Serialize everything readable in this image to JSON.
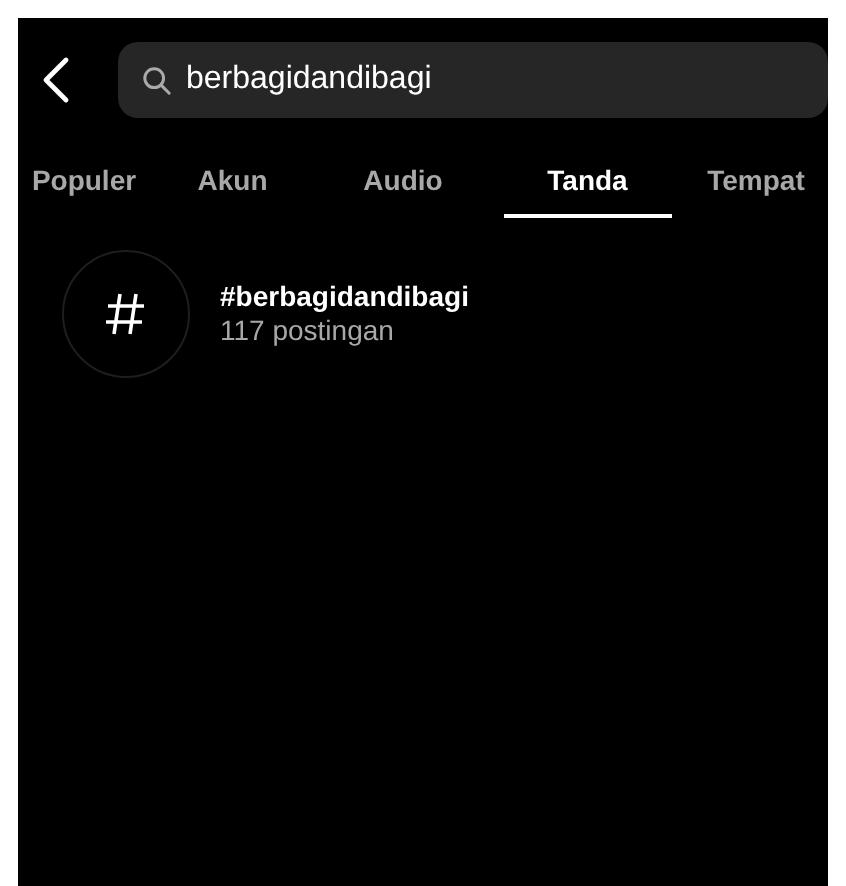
{
  "search": {
    "value": "berbagidandibagi"
  },
  "tabs": [
    {
      "label": "Populer",
      "selected": false
    },
    {
      "label": "Akun",
      "selected": false
    },
    {
      "label": "Audio",
      "selected": false
    },
    {
      "label": "Tanda",
      "selected": true
    },
    {
      "label": "Tempat",
      "selected": false
    }
  ],
  "results": [
    {
      "title": "#berbagidandibagi",
      "subtitle": "117 postingan"
    }
  ]
}
